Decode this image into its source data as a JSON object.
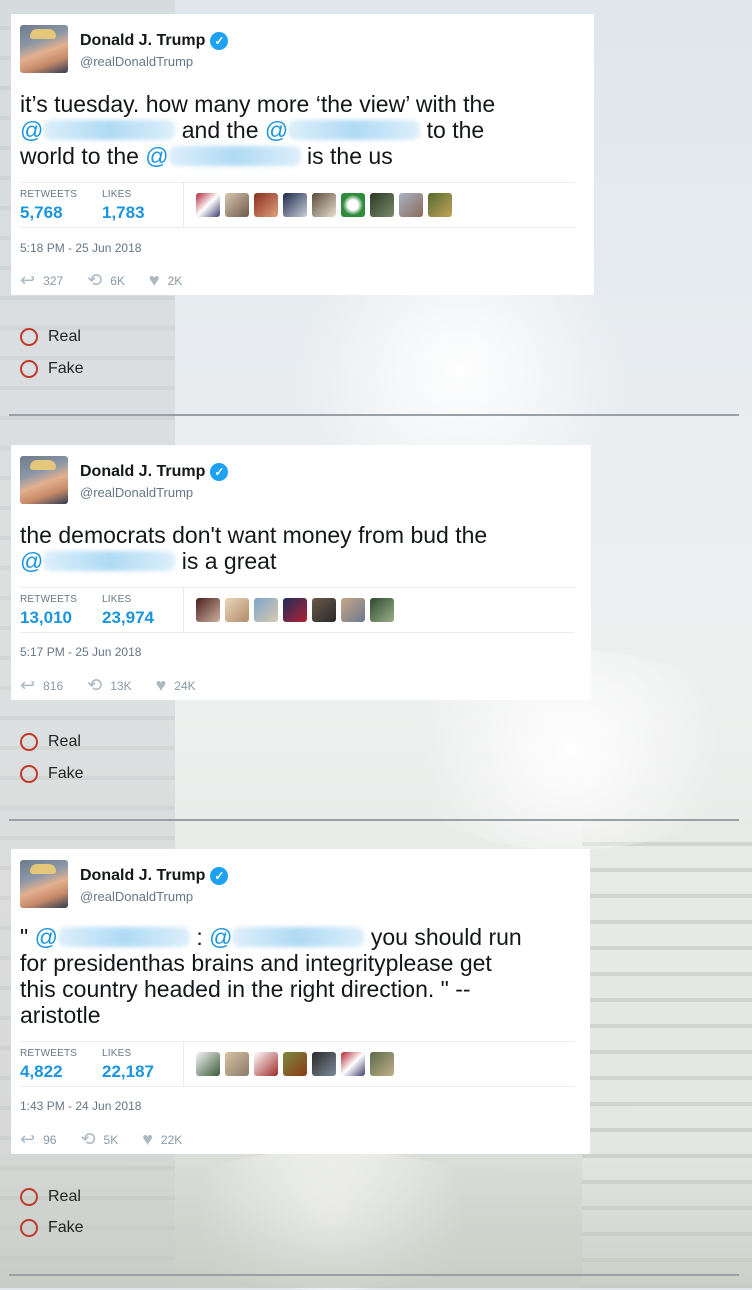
{
  "tweets": [
    {
      "name": "Donald J. Trump",
      "handle": "@realDonaldTrump",
      "text_parts": [
        "it’s tuesday. how many more ‘the view’ with the",
        "and the",
        "to the",
        "world to the",
        "is the us"
      ],
      "mention_symbol": "@",
      "retweets_label": "RETWEETS",
      "retweets": "5,768",
      "likes_label": "LIKES",
      "likes": "1,783",
      "timestamp": "5:18 PM - 25 Jun 2018",
      "replies_count": "327",
      "retweet_count_short": "6K",
      "likes_count_short": "2K"
    },
    {
      "name": "Donald J. Trump",
      "handle": "@realDonaldTrump",
      "text_parts": [
        "the democrats don't want money from bud the",
        "is a great"
      ],
      "mention_symbol": "@",
      "retweets_label": "RETWEETS",
      "retweets": "13,010",
      "likes_label": "LIKES",
      "likes": "23,974",
      "timestamp": "5:17 PM - 25 Jun 2018",
      "replies_count": "816",
      "retweet_count_short": "13K",
      "likes_count_short": "24K"
    },
    {
      "name": "Donald J. Trump",
      "handle": "@realDonaldTrump",
      "text_parts": [
        "\"",
        ":",
        "you should run",
        "for presidenthas brains and integrityplease get",
        "this country headed in the right direction. \" --",
        "aristotle"
      ],
      "mention_symbol": "@",
      "retweets_label": "RETWEETS",
      "retweets": "4,822",
      "likes_label": "LIKES",
      "likes": "22,187",
      "timestamp": "1:43 PM - 24 Jun 2018",
      "replies_count": "96",
      "retweet_count_short": "5K",
      "likes_count_short": "22K"
    }
  ],
  "choices": {
    "real": "Real",
    "fake": "Fake"
  },
  "icons": {
    "verified": "✓",
    "reply": "↩",
    "retweet": "⟲",
    "like": "♥"
  },
  "colors": {
    "mention": "#1b95e0",
    "verified": "#1da1f2",
    "radio": "#c0392b"
  }
}
